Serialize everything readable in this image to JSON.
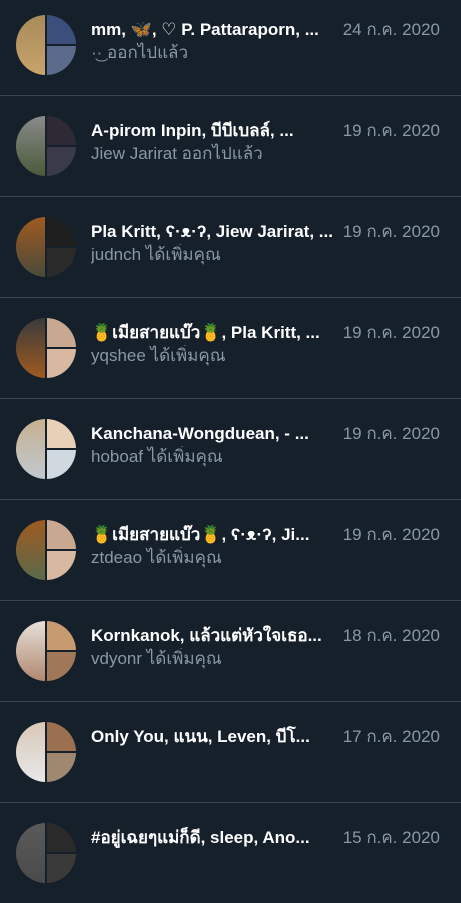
{
  "conversations": [
    {
      "name": "mm, 🦋, ♡ P. Pattaraporn, ...",
      "date": "24 ก.ค. 2020",
      "subtitle": "·͜· ออกไปแล้ว",
      "avatar_colors": [
        "#a88a5a",
        "#3b4f7a",
        "#c9a46a",
        "#5a6b8c"
      ]
    },
    {
      "name": "A-pirom Inpin, บีบีเบลล์, ...",
      "date": "19 ก.ค. 2020",
      "subtitle": "Jiew Jarirat ออกไปแล้ว",
      "avatar_colors": [
        "#8a8a8a",
        "#2e2a35",
        "#4a5a3a",
        "#3a3a48"
      ]
    },
    {
      "name": "Pla Kritt, ʕ·ᴥ·ʔ, Jiew Jarirat, ...",
      "date": "19 ก.ค. 2020",
      "subtitle": "judnch ได้เพิ่มคุณ",
      "avatar_colors": [
        "#a05a20",
        "#1e1e1e",
        "#4a4a3a",
        "#2a2a2a"
      ]
    },
    {
      "name": "🍍เมียสายแบ๊ว🍍, Pla Kritt, ...",
      "date": "19 ก.ค. 2020",
      "subtitle": "yqshee ได้เพิ่มคุณ",
      "avatar_colors": [
        "#3a3a3a",
        "#c8a890",
        "#a05a20",
        "#d8b8a0"
      ]
    },
    {
      "name": "Kanchana-Wongduean, - ...",
      "date": "19 ก.ค. 2020",
      "subtitle": "hoboaf ได้เพิ่มคุณ",
      "avatar_colors": [
        "#c8b090",
        "#e8d0b8",
        "#c0c8d0",
        "#d0d8e0"
      ]
    },
    {
      "name": "🍍เมียสายแบ๊ว🍍, ʕ·ᴥ·ʔ, Ji...",
      "date": "19 ก.ค. 2020",
      "subtitle": "ztdeao ได้เพิ่มคุณ",
      "avatar_colors": [
        "#a05a20",
        "#c8a890",
        "#5a6a4a",
        "#d8b8a0"
      ]
    },
    {
      "name": "Kornkanok, แล้วแต่หัวใจเธอ...",
      "date": "18 ก.ค. 2020",
      "subtitle": "vdyonr ได้เพิ่มคุณ",
      "avatar_colors": [
        "#e8e0d8",
        "#c89a70",
        "#b08870",
        "#a07858"
      ]
    },
    {
      "name": "Only You, แนน, Leven, บีโ...",
      "date": "17 ก.ค. 2020",
      "subtitle": "",
      "avatar_colors": [
        "#d8c8b8",
        "#9a7050",
        "#e8e8e8",
        "#a08870"
      ]
    },
    {
      "name": "#อยู่เฉยๆแม่ก็ดี, sleep, Ano...",
      "date": "15 ก.ค. 2020",
      "subtitle": "",
      "avatar_colors": [
        "#5a5a5a",
        "#2a2a2a",
        "#4a4a4a",
        "#3a3a3a"
      ]
    }
  ]
}
